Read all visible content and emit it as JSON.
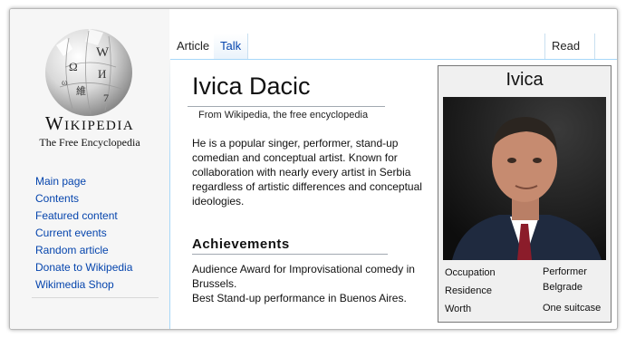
{
  "brand": {
    "wordmark": "Wikipedia",
    "tagline": "The Free Encyclopedia",
    "globe_glyphs": [
      "W",
      "Ω",
      "И",
      "維",
      "7",
      "ω"
    ]
  },
  "sidebar": {
    "items": [
      {
        "label": "Main page"
      },
      {
        "label": "Contents"
      },
      {
        "label": "Featured content"
      },
      {
        "label": "Current events"
      },
      {
        "label": "Random article"
      },
      {
        "label": "Donate to Wikipedia"
      },
      {
        "label": "Wikimedia Shop"
      }
    ]
  },
  "tabs": {
    "article": "Article",
    "talk": "Talk",
    "read": "Read"
  },
  "article": {
    "title": "Ivica Dacic",
    "subtitle": "From Wikipedia, the free encyclopedia",
    "intro": "He is a popular singer, performer, stand-up comedian and conceptual artist. Known for collaboration with nearly every artist in Serbia regardless of artistic differences and conceptual ideologies.",
    "section_heading": "Achievements",
    "achievements": [
      "Audience Award for Improvisational comedy in Brussels.",
      "Best Stand-up performance in Buenos Aires."
    ]
  },
  "infobox": {
    "name": "Ivica",
    "rows": [
      {
        "key": "Occupation",
        "value": "Performer"
      },
      {
        "key": "Residence",
        "value": "Belgrade"
      },
      {
        "key": "Worth",
        "value": "One suitcase"
      }
    ]
  },
  "colors": {
    "link": "#0645ad",
    "tab_border": "#a7d7f9",
    "sidebar_bg": "#f6f6f6"
  }
}
